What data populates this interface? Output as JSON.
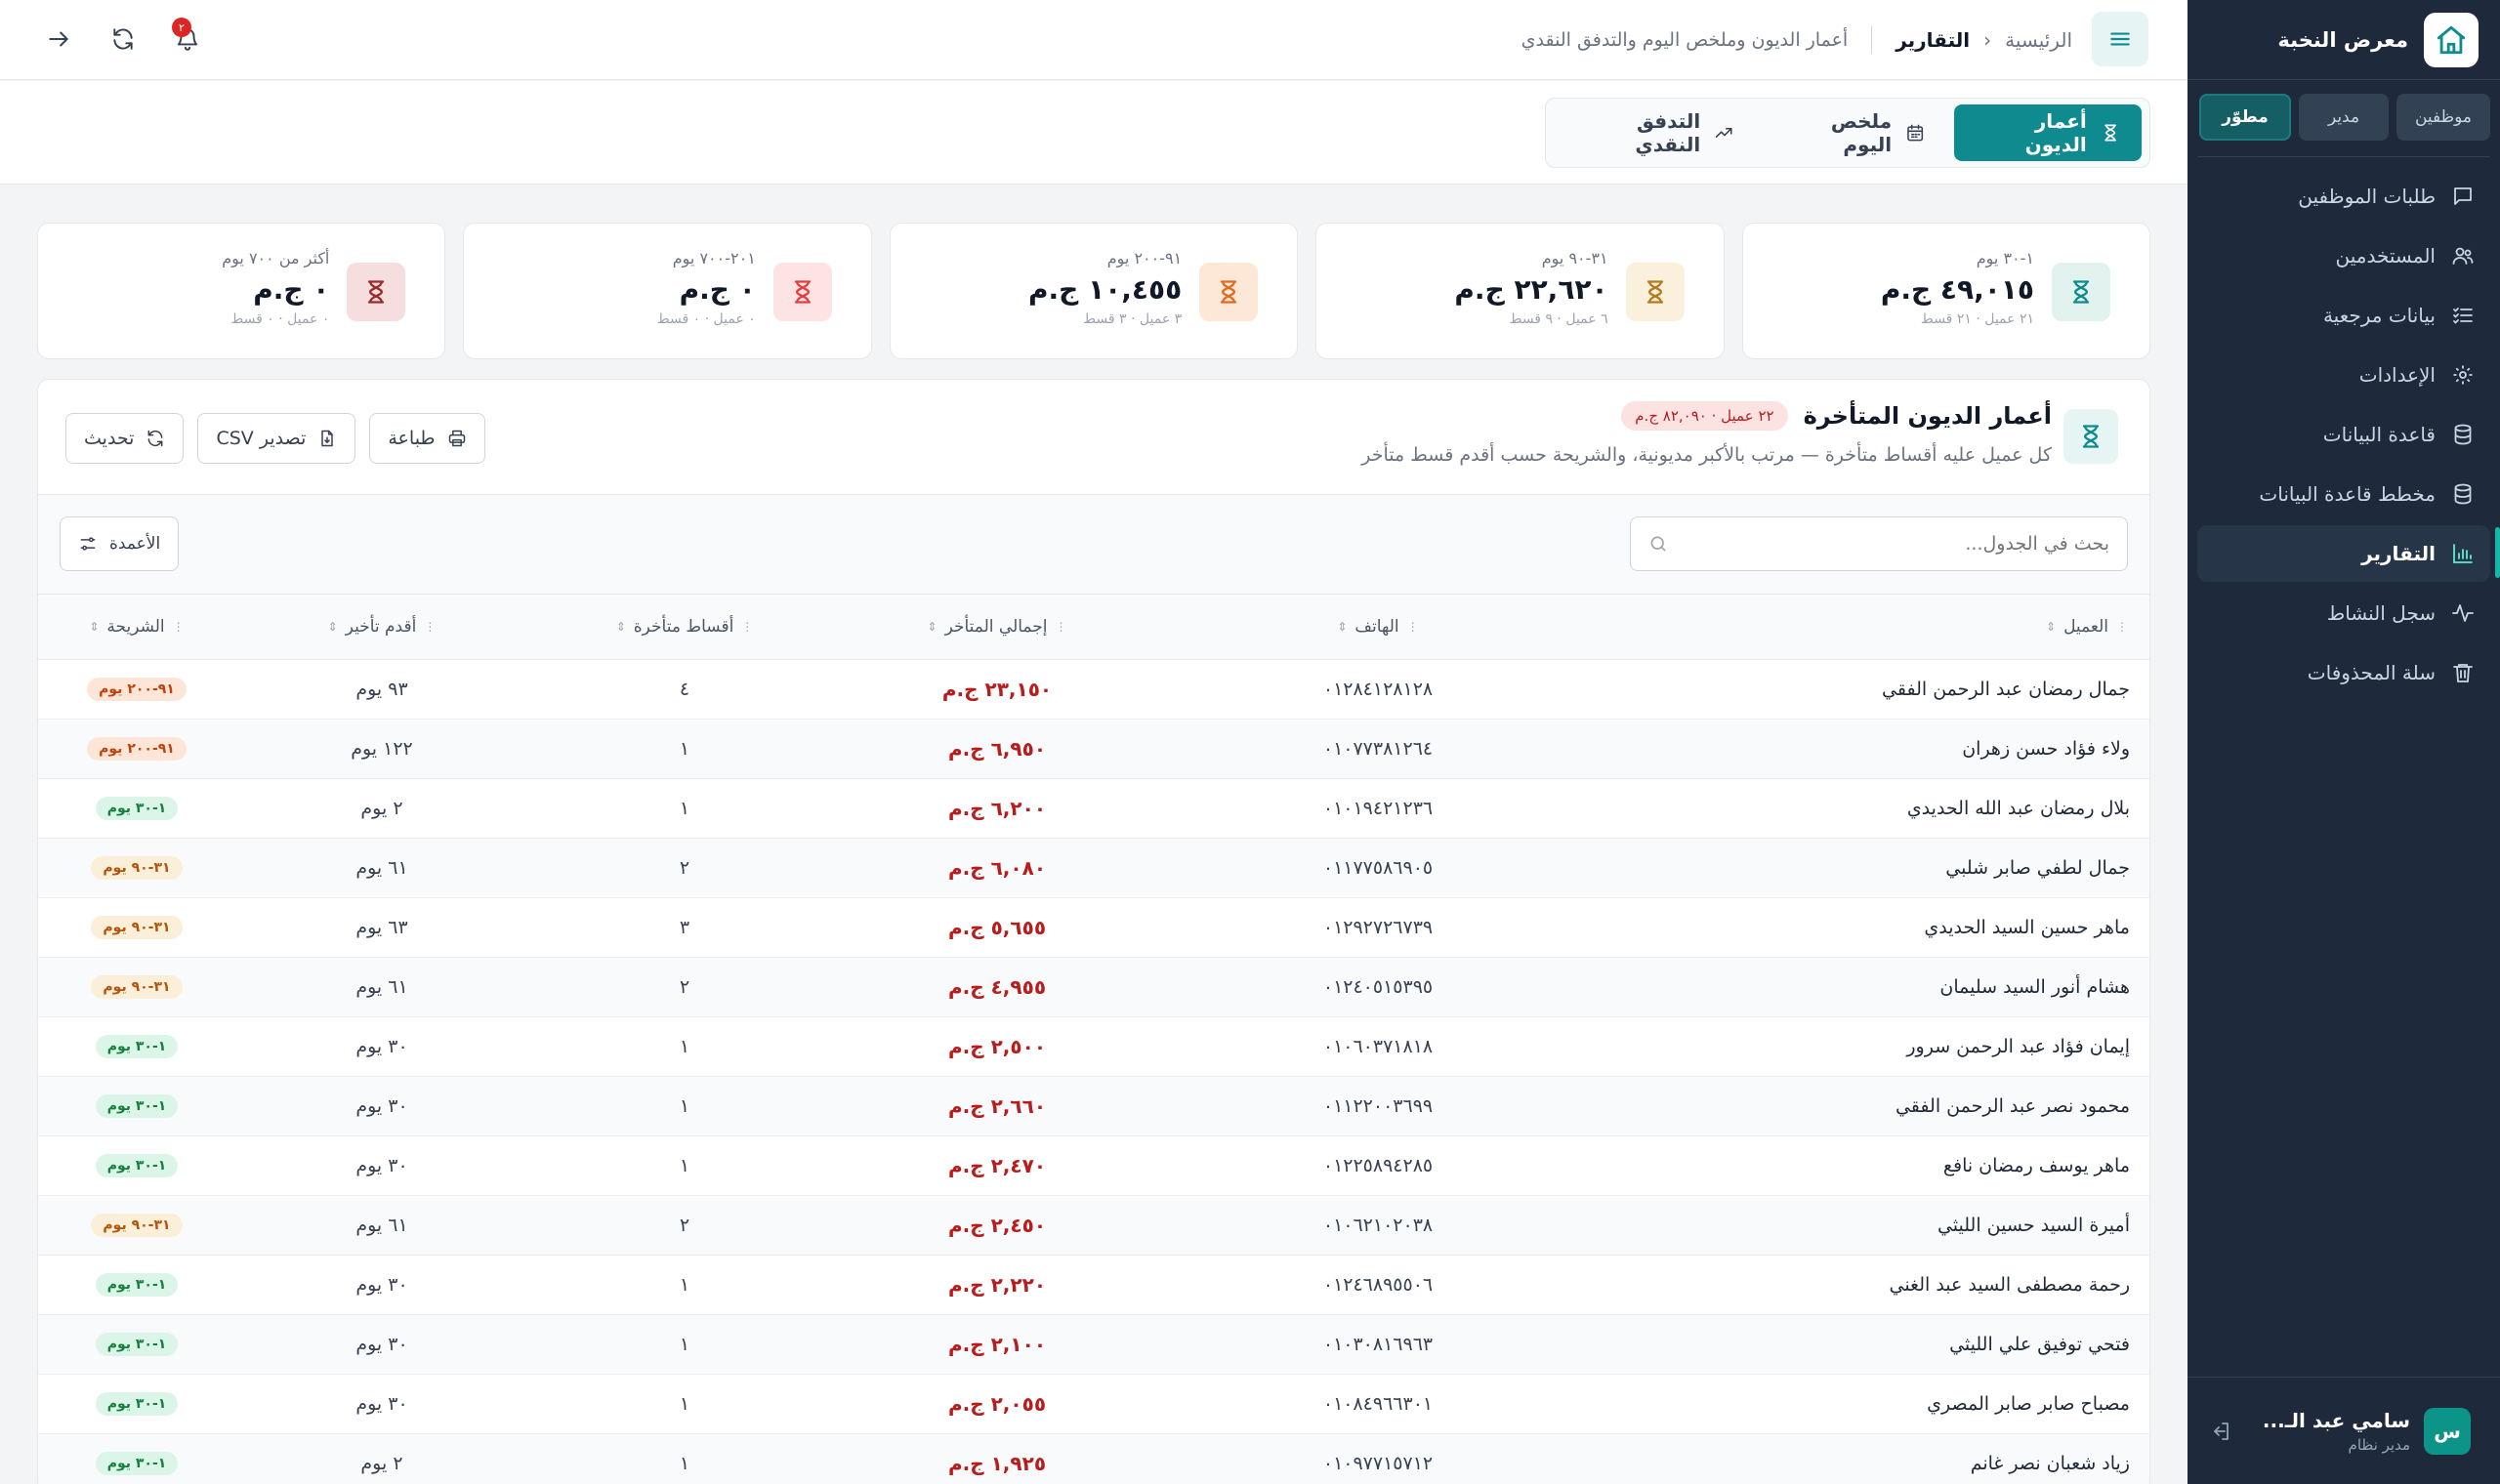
{
  "app": {
    "name": "معرض النخبة",
    "roles": [
      "موظفين",
      "مدير",
      "مطوّر"
    ],
    "active_role": "مطوّر"
  },
  "sidebar": {
    "items": [
      {
        "label": "طلبات الموظفين",
        "icon": "message-icon"
      },
      {
        "label": "المستخدمين",
        "icon": "users-icon"
      },
      {
        "label": "بيانات مرجعية",
        "icon": "list-check-icon"
      },
      {
        "label": "الإعدادات",
        "icon": "gear-icon"
      },
      {
        "label": "قاعدة البيانات",
        "icon": "database-icon"
      },
      {
        "label": "مخطط قاعدة البيانات",
        "icon": "database-schema-icon"
      },
      {
        "label": "التقارير",
        "icon": "bar-chart-icon",
        "active": true
      },
      {
        "label": "سجل النشاط",
        "icon": "activity-icon"
      },
      {
        "label": "سلة المحذوفات",
        "icon": "trash-icon"
      }
    ]
  },
  "user": {
    "initial": "س",
    "name": "سامي عبد الـ...",
    "role": "مدير نظام"
  },
  "header": {
    "crumb_home": "الرئيسية",
    "crumb_current": "التقارير",
    "subtitle": "أعمار الديون وملخص اليوم والتدفق النقدي",
    "notification_count": "٢"
  },
  "tabs": [
    {
      "label": "أعمار الديون",
      "icon": "hourglass-icon",
      "active": true
    },
    {
      "label": "ملخص اليوم",
      "icon": "calendar-icon"
    },
    {
      "label": "التدفق النقدي",
      "icon": "trending-up-icon"
    }
  ],
  "aging_cards": [
    {
      "range": "١-٣٠ يوم",
      "amount": "٤٩,٠١٥ ج.م",
      "meta": "٢١ عميل · ٢١ قسط",
      "color": "#0f8a8f",
      "bg": "#e2f2ee"
    },
    {
      "range": "٣١-٩٠ يوم",
      "amount": "٢٢,٦٢٠ ج.م",
      "meta": "٦ عميل · ٩ قسط",
      "color": "#b7791f",
      "bg": "#fbf0db"
    },
    {
      "range": "٩١-٢٠٠ يوم",
      "amount": "١٠,٤٥٥ ج.م",
      "meta": "٣ عميل · ٣ قسط",
      "color": "#dd6b20",
      "bg": "#fde8d7"
    },
    {
      "range": "٢٠١-٧٠٠ يوم",
      "amount": "٠ ج.م",
      "meta": "٠ عميل · ٠ قسط",
      "color": "#e53e3e",
      "bg": "#fde3e3"
    },
    {
      "range": "أكثر من ٧٠٠ يوم",
      "amount": "٠ ج.م",
      "meta": "٠ عميل · ٠ قسط",
      "color": "#9b2c2c",
      "bg": "#f6dede"
    }
  ],
  "panel": {
    "title": "أعمار الديون المتأخرة",
    "badge": "٢٢ عميل · ٨٢,٠٩٠ ج.م",
    "description": "كل عميل عليه أقساط متأخرة — مرتب بالأكبر مديونية، والشريحة حسب أقدم قسط متأخر",
    "buttons": {
      "refresh": "تحديث",
      "export": "تصدير CSV",
      "print": "طباعة"
    }
  },
  "search": {
    "placeholder": "بحث في الجدول..."
  },
  "columns_button": "الأعمدة",
  "table": {
    "headers": [
      "العميل",
      "الهاتف",
      "إجمالي المتأخر",
      "أقساط متأخرة",
      "أقدم تأخير",
      "الشريحة"
    ],
    "rows": [
      {
        "name": "جمال رمضان عبد الرحمن الفقي",
        "phone": "٠١٢٨٤١٢٨١٢٨",
        "total": "٢٣,١٥٠ ج.م",
        "count": "٤",
        "oldest": "٩٣ يوم",
        "bucket": "٩١-٢٠٠ يوم",
        "tone": "orange"
      },
      {
        "name": "ولاء فؤاد حسن زهران",
        "phone": "٠١٠٧٧٣٨١٢٦٤",
        "total": "٦,٩٥٠ ج.م",
        "count": "١",
        "oldest": "١٢٢ يوم",
        "bucket": "٩١-٢٠٠ يوم",
        "tone": "orange"
      },
      {
        "name": "بلال رمضان عبد الله الحديدي",
        "phone": "٠١٠١٩٤٢١٢٣٦",
        "total": "٦,٢٠٠ ج.م",
        "count": "١",
        "oldest": "٢ يوم",
        "bucket": "١-٣٠ يوم",
        "tone": "green"
      },
      {
        "name": "جمال لطفي صابر شلبي",
        "phone": "٠١١٧٧٥٨٦٩٠٥",
        "total": "٦,٠٨٠ ج.م",
        "count": "٢",
        "oldest": "٦١ يوم",
        "bucket": "٣١-٩٠ يوم",
        "tone": "yellow"
      },
      {
        "name": "ماهر حسين السيد الحديدي",
        "phone": "٠١٢٩٢٧٢٦٧٣٩",
        "total": "٥,٦٥٥ ج.م",
        "count": "٣",
        "oldest": "٦٣ يوم",
        "bucket": "٣١-٩٠ يوم",
        "tone": "yellow"
      },
      {
        "name": "هشام أنور السيد سليمان",
        "phone": "٠١٢٤٠٥١٥٣٩٥",
        "total": "٤,٩٥٥ ج.م",
        "count": "٢",
        "oldest": "٦١ يوم",
        "bucket": "٣١-٩٠ يوم",
        "tone": "yellow"
      },
      {
        "name": "إيمان فؤاد عبد الرحمن سرور",
        "phone": "٠١٠٦٠٣٧١٨١٨",
        "total": "٢,٥٠٠ ج.م",
        "count": "١",
        "oldest": "٣٠ يوم",
        "bucket": "١-٣٠ يوم",
        "tone": "green"
      },
      {
        "name": "محمود نصر عبد الرحمن الفقي",
        "phone": "٠١١٢٢٠٠٣٦٩٩",
        "total": "٢,٦٦٠ ج.م",
        "count": "١",
        "oldest": "٣٠ يوم",
        "bucket": "١-٣٠ يوم",
        "tone": "green"
      },
      {
        "name": "ماهر يوسف رمضان نافع",
        "phone": "٠١٢٢٥٨٩٤٢٨٥",
        "total": "٢,٤٧٠ ج.م",
        "count": "١",
        "oldest": "٣٠ يوم",
        "bucket": "١-٣٠ يوم",
        "tone": "green"
      },
      {
        "name": "أميرة السيد حسين الليثي",
        "phone": "٠١٠٦٢١٠٢٠٣٨",
        "total": "٢,٤٥٠ ج.م",
        "count": "٢",
        "oldest": "٦١ يوم",
        "bucket": "٣١-٩٠ يوم",
        "tone": "yellow"
      },
      {
        "name": "رحمة مصطفى السيد عبد الغني",
        "phone": "٠١٢٤٦٨٩٥٥٠٦",
        "total": "٢,٢٢٠ ج.م",
        "count": "١",
        "oldest": "٣٠ يوم",
        "bucket": "١-٣٠ يوم",
        "tone": "green"
      },
      {
        "name": "فتحي توفيق علي الليثي",
        "phone": "٠١٠٣٠٨١٦٩٦٣",
        "total": "٢,١٠٠ ج.م",
        "count": "١",
        "oldest": "٣٠ يوم",
        "bucket": "١-٣٠ يوم",
        "tone": "green"
      },
      {
        "name": "مصباح صابر صابر المصري",
        "phone": "٠١٠٨٤٩٦٦٣٠١",
        "total": "٢,٠٥٥ ج.م",
        "count": "١",
        "oldest": "٣٠ يوم",
        "bucket": "١-٣٠ يوم",
        "tone": "green"
      },
      {
        "name": "زياد شعبان نصر غانم",
        "phone": "٠١٠٩٧٧١٥٧١٢",
        "total": "١,٩٢٥ ج.م",
        "count": "١",
        "oldest": "٢ يوم",
        "bucket": "١-٣٠ يوم",
        "tone": "green"
      }
    ]
  }
}
